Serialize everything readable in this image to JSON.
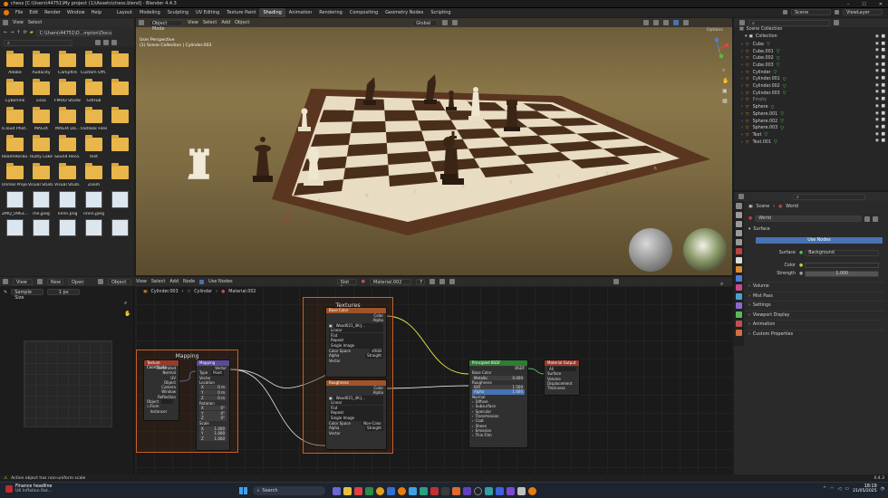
{
  "titlebar": {
    "title": "chess [C:\\Users\\44751\\My project (1)\\Assets\\chess.blend] - Blender 4.4.3"
  },
  "menu": {
    "items": [
      "File",
      "Edit",
      "Render",
      "Window",
      "Help"
    ],
    "workspaces": [
      "Layout",
      "Modeling",
      "Sculpting",
      "UV Editing",
      "Texture Paint",
      "Shading",
      "Animation",
      "Rendering",
      "Compositing",
      "Geometry Nodes",
      "Scripting"
    ],
    "active_workspace": "Shading",
    "scene": "Scene",
    "view_layer": "ViewLayer"
  },
  "file_browser": {
    "header": {
      "view": "View",
      "select": "Select"
    },
    "path": "C:\\Users\\44751\\O...mpton\\Documents\\",
    "items": [
      {
        "name": "Adobe",
        "type": "folder"
      },
      {
        "name": "Audacity",
        "type": "folder"
      },
      {
        "name": "Campfire",
        "type": "folder"
      },
      {
        "name": "Custom Offi...",
        "type": "folder"
      },
      {
        "name": "",
        "type": "folder"
      },
      {
        "name": "Cyberlink",
        "type": "folder"
      },
      {
        "name": "Essa",
        "type": "folder"
      },
      {
        "name": "FMOD Studio",
        "type": "folder"
      },
      {
        "name": "GitHub",
        "type": "folder"
      },
      {
        "name": "",
        "type": "folder"
      },
      {
        "name": "iCloud Phot...",
        "type": "folder"
      },
      {
        "name": "MAGIX",
        "type": "folder"
      },
      {
        "name": "MAGIX Do...",
        "type": "folder"
      },
      {
        "name": "Outlook Files",
        "type": "folder"
      },
      {
        "name": "",
        "type": "folder"
      },
      {
        "name": "RealmRecko...",
        "type": "folder"
      },
      {
        "name": "Rusty Lake",
        "type": "folder"
      },
      {
        "name": "Sound Reco...",
        "type": "folder"
      },
      {
        "name": "test",
        "type": "folder"
      },
      {
        "name": "",
        "type": "folder"
      },
      {
        "name": "Unreal Proje...",
        "type": "folder"
      },
      {
        "name": "Visual Studi...",
        "type": "folder"
      },
      {
        "name": "Visual Studi...",
        "type": "folder"
      },
      {
        "name": "Zoom",
        "type": "folder"
      },
      {
        "name": "",
        "type": "folder"
      },
      {
        "name": "ZMQ_0963...",
        "type": "image"
      },
      {
        "name": "me.jpeg",
        "type": "image"
      },
      {
        "name": "nnnn.png",
        "type": "image"
      },
      {
        "name": "nnnn.jpeg",
        "type": "image"
      },
      {
        "name": "",
        "type": "image"
      },
      {
        "name": "",
        "type": "image"
      },
      {
        "name": "",
        "type": "image"
      },
      {
        "name": "",
        "type": "image"
      },
      {
        "name": "",
        "type": "image"
      },
      {
        "name": "",
        "type": "image"
      }
    ]
  },
  "viewport": {
    "mode": "Object Mode",
    "menus": [
      "View",
      "Select",
      "Add",
      "Object"
    ],
    "options": "Options",
    "global": "Global",
    "info1": "User Perspective",
    "info2": "(1) Scene Collection | Cylinder.003",
    "board_files": [
      "a",
      "b",
      "c",
      "d",
      "e",
      "f",
      "g",
      "h"
    ]
  },
  "outliner": {
    "title": "Scene Collection",
    "collection": "Collection",
    "items": [
      "Cube",
      "Cube.001",
      "Cube.002",
      "Cube.003",
      "Cylinder",
      "Cylinder.001",
      "Cylinder.002",
      "Cylinder.003",
      "Empty",
      "Sphere",
      "Sphere.001",
      "Sphere.002",
      "Sphere.003",
      "Text",
      "Text.001"
    ]
  },
  "properties": {
    "breadcrumb_scene": "Scene",
    "breadcrumb_world": "World",
    "world_name": "World",
    "surface_header": "Surface",
    "use_nodes": "Use Nodes",
    "surface_label": "Surface",
    "surface_value": "Background",
    "color_label": "Color",
    "strength_label": "Strength",
    "strength_value": "1.000",
    "panels": [
      "Volume",
      "Mist Pass",
      "Settings",
      "Viewport Display",
      "Animation",
      "Custom Properties"
    ]
  },
  "node_editor": {
    "menus": [
      "View",
      "Select",
      "Add",
      "Node"
    ],
    "object": "Object",
    "use_nodes": "Use Nodes",
    "slot": "Slot 1",
    "material": "Material.002",
    "users": "7",
    "breadcrumb": [
      "Cylinder.003",
      "Cylinder",
      "Material.002"
    ],
    "tool_view": "View",
    "new": "New",
    "open": "Open",
    "sample_size_label": "Sample Size",
    "sample_size": "1 px",
    "frame_mapping": "Mapping",
    "frame_textures": "Textures",
    "texcoord": {
      "title": "Texture Coordinate",
      "outputs": [
        "Generated",
        "Normal",
        "UV",
        "Object",
        "Camera",
        "Window",
        "Reflection"
      ],
      "object_label": "Object",
      "from_instancer": "From Instancer"
    },
    "mapping": {
      "title": "Mapping",
      "output": "Vector",
      "type_label": "Type",
      "type": "Point",
      "vector": "Vector",
      "location": "Location",
      "rotation": "Rotation",
      "scale": "Scale",
      "loc": [
        "0 m",
        "0 m",
        "0 m"
      ],
      "rot": [
        "0°",
        "0°",
        "0°"
      ],
      "scl": [
        "1.000",
        "1.000",
        "1.000"
      ],
      "axes": [
        "X",
        "Y",
        "Z"
      ]
    },
    "basecolor_tex": {
      "title": "Base Color",
      "outputs": [
        "Color",
        "Alpha"
      ],
      "image": "Wood021_4K-J...",
      "opts": [
        "Linear",
        "Flat",
        "Repeat",
        "Single Image"
      ],
      "cs_label": "Color Space",
      "cs": "sRGB",
      "alpha_label": "Alpha",
      "alpha": "Straight",
      "vector": "Vector"
    },
    "rough_tex": {
      "title": "Roughness",
      "outputs": [
        "Color",
        "Alpha"
      ],
      "image": "Wood021_4K-J...",
      "opts": [
        "Linear",
        "Flat",
        "Repeat",
        "Single Image"
      ],
      "cs_label": "Color Space",
      "cs": "Non-Color",
      "alpha_label": "Alpha",
      "alpha": "Straight",
      "vector": "Vector"
    },
    "bsdf": {
      "title": "Principled BSDF",
      "output": "BSDF",
      "inputs": [
        "Base Color",
        "Metallic",
        "Roughness",
        "IOR",
        "Alpha",
        "Normal"
      ],
      "metallic": "0.000",
      "ior": "1.500",
      "alpha": "1.000",
      "panels": [
        "Diffuse",
        "Subsurface",
        "Specular",
        "Transmission",
        "Coat",
        "Sheen",
        "Emission",
        "Thin Film"
      ]
    },
    "output": {
      "title": "Material Output",
      "target": "All",
      "inputs": [
        "Surface",
        "Volume",
        "Displacement",
        "Thickness"
      ]
    }
  },
  "status": {
    "message": "Active object has non-uniform scale",
    "version": "4.4.3"
  },
  "taskbar": {
    "news_title": "Finance headline",
    "news_sub": "UK Inflation Rat...",
    "search": "Search",
    "time": "18:19",
    "date": "21/05/2025"
  },
  "colors": {
    "folder": "#e9b64b",
    "accent": "#4772b3",
    "node_frame": "#c8602a",
    "bsdf_header": "#2e7d32",
    "texture_header": "#a0542a"
  }
}
